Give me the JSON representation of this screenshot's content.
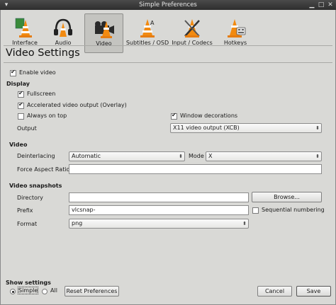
{
  "window": {
    "title": "Simple Preferences"
  },
  "categories": [
    {
      "label": "Interface",
      "icon": "interface-cone-icon"
    },
    {
      "label": "Audio",
      "icon": "audio-headphones-icon"
    },
    {
      "label": "Video",
      "icon": "video-cone-icon",
      "active": true
    },
    {
      "label": "Subtitles / OSD",
      "icon": "subtitles-cone-icon"
    },
    {
      "label": "Input / Codecs",
      "icon": "input-codecs-icon"
    },
    {
      "label": "Hotkeys",
      "icon": "hotkeys-icon"
    }
  ],
  "page_title": "Video Settings",
  "enable_video": {
    "label": "Enable video",
    "checked": true
  },
  "display": {
    "heading": "Display",
    "fullscreen": {
      "label": "Fullscreen",
      "checked": true
    },
    "overlay": {
      "label": "Accelerated video output (Overlay)",
      "checked": true
    },
    "always_on_top": {
      "label": "Always on top",
      "checked": false
    },
    "window_decorations": {
      "label": "Window decorations",
      "checked": true
    },
    "output_label": "Output",
    "output_value": "X11 video output (XCB)"
  },
  "video": {
    "heading": "Video",
    "deinterlacing_label": "Deinterlacing",
    "deinterlacing_value": "Automatic",
    "mode_label": "Mode",
    "mode_value": "X",
    "aspect_label": "Force Aspect Ratio",
    "aspect_value": ""
  },
  "snapshots": {
    "heading": "Video snapshots",
    "directory_label": "Directory",
    "directory_value": "",
    "browse_label": "Browse...",
    "prefix_label": "Prefix",
    "prefix_value": "vlcsnap-",
    "sequential_label": "Sequential numbering",
    "sequential_checked": false,
    "format_label": "Format",
    "format_value": "png"
  },
  "footer": {
    "show_settings": "Show settings",
    "simple_label": "Simple",
    "all_label": "All",
    "simple_selected": true,
    "reset_label": "Reset Preferences",
    "cancel_label": "Cancel",
    "save_label": "Save"
  }
}
